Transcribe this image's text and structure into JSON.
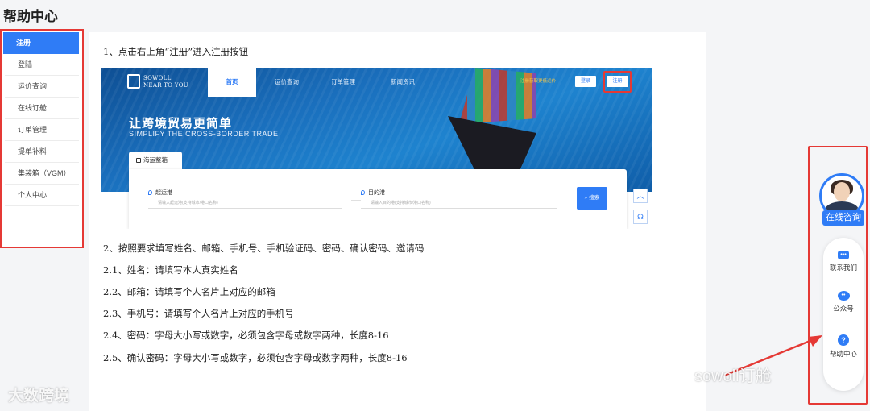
{
  "page": {
    "title": "帮助中心"
  },
  "sidebar": {
    "items": [
      {
        "label": "注册",
        "active": true
      },
      {
        "label": "登陆"
      },
      {
        "label": "运价查询"
      },
      {
        "label": "在线订舱"
      },
      {
        "label": "订单管理"
      },
      {
        "label": "提单补料"
      },
      {
        "label": "集装箱（VGM）"
      },
      {
        "label": "个人中心"
      }
    ]
  },
  "content": {
    "step1": "1、点击右上角“注册”进入注册按钮",
    "step2": "2、按照要求填写姓名、邮箱、手机号、手机验证码、密码、确认密码、邀请码",
    "step2_1": "2.1、姓名：请填写本人真实姓名",
    "step2_2": "2.2、邮箱：请填写个人名片上对应的邮箱",
    "step2_3": "2.3、手机号：请填写个人名片上对应的手机号",
    "step2_4": "2.4、密码：字母大小写或数字，必须包含字母或数字两种，长度8-16",
    "step2_5": "2.5、确认密码：字母大小写或数字，必须包含字母或数字两种，长度8-16"
  },
  "site_screenshot": {
    "logo_line1": "SOWOLL",
    "logo_line2": "NEAR TO YOU",
    "nav": [
      "首页",
      "运价查询",
      "订单管理",
      "新闻资讯"
    ],
    "promo": "注册获取更低运价",
    "login_label": "登录",
    "register_label": "注册",
    "hero_title": "让跨境贸易更简单",
    "hero_subtitle": "SIMPLIFY THE CROSS-BORDER TRADE",
    "tab_label": "海运整箱",
    "origin_label": "起运港",
    "origin_hint": "请输入起运港(支持城市/港口名称)",
    "dest_label": "目的港",
    "dest_hint": "请输入目的港(支持城市/港口名称)",
    "dash": "——",
    "search_label": "搜索",
    "colors": {
      "brand": "#2f7cf6",
      "highlight": "#e53935"
    }
  },
  "float_panel": {
    "online_label": "在线咨询",
    "items": [
      {
        "label": "联系我们",
        "icon": "chat-bubble-icon"
      },
      {
        "label": "公众号",
        "icon": "wechat-icon"
      },
      {
        "label": "帮助中心",
        "icon": "question-icon"
      }
    ]
  },
  "watermarks": {
    "left": "大数跨境",
    "right": "sowoll订舱"
  }
}
